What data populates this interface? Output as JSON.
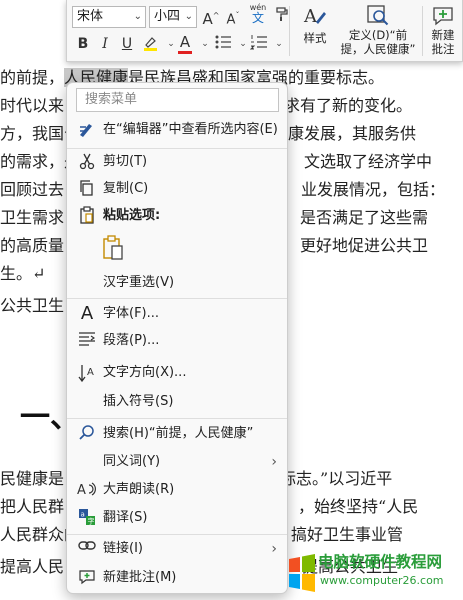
{
  "document": {
    "lines": [
      {
        "pre": "的前提，",
        "sel": "人民健康",
        "post": "是民族昌盛和国家富强的重要标志。"
      },
      {
        "pre": "时代以来",
        "sel": "",
        "post": "求有了新的变化。"
      },
      {
        "pre": "方，我国公",
        "sel": "",
        "post": "康发展，其服务供"
      },
      {
        "pre": "的需求，是",
        "sel": "",
        "post": "文选取了经济学中"
      },
      {
        "pre": "回顾过去",
        "sel": "",
        "post": "业发展情况，包括："
      },
      {
        "pre": "卫生需求，",
        "sel": "",
        "post": "是否满足了这些需"
      },
      {
        "pre": "的高质量",
        "sel": "",
        "post": "更好地促进公共卫"
      },
      {
        "pre": "生。↵",
        "sel": "",
        "post": ""
      },
      {
        "pre": "公共卫生",
        "sel": "",
        "post": ""
      }
    ],
    "heading": "一、",
    "lower_lines": [
      {
        "pre": "民健康是",
        "post": "标志。”以习近平"
      },
      {
        "pre": "把人民群",
        "post": "，始终坚持“人民"
      },
      {
        "pre": "人民群众的",
        "post": "搞好卫生事业管"
      },
      {
        "pre": "提高人民",
        "post": "提高公共卫生"
      }
    ]
  },
  "toolbar": {
    "font_name": "宋体",
    "font_size": "小四",
    "styles_label": "样式",
    "define_label_1": "定义(D)“前",
    "define_label_2": "提，人民健康”",
    "new_comment_1": "新建",
    "new_comment_2": "批注",
    "wen_label": "wén",
    "wen_char": "文"
  },
  "menu": {
    "search_placeholder": "搜索菜单",
    "items": [
      {
        "label": "在“编辑器”中查看所选内容(E)",
        "icon": "editor-icon"
      },
      {
        "label": "剪切(T)",
        "icon": "scissors-icon"
      },
      {
        "label": "复制(C)",
        "icon": "copy-icon"
      },
      {
        "label": "粘贴选项:",
        "icon": "paste-icon"
      },
      {
        "label": "汉字重选(V)",
        "icon": ""
      },
      {
        "label": "字体(F)...",
        "icon": "font-icon"
      },
      {
        "label": "段落(P)...",
        "icon": "paragraph-icon"
      },
      {
        "label": "文字方向(X)...",
        "icon": "text-direction-icon"
      },
      {
        "label": "插入符号(S)",
        "icon": ""
      },
      {
        "label": "搜索(H)“前提，人民健康”",
        "icon": "search-icon"
      },
      {
        "label": "同义词(Y)",
        "icon": ""
      },
      {
        "label": "大声朗读(R)",
        "icon": "read-aloud-icon"
      },
      {
        "label": "翻译(S)",
        "icon": "translate-icon"
      },
      {
        "label": "链接(I)",
        "icon": "link-icon"
      },
      {
        "label": "新建批注(M)",
        "icon": "new-comment-icon"
      }
    ]
  },
  "watermark": {
    "title": "电脑软硬件教程网",
    "url": "www.computer26.com"
  },
  "colors": {
    "accent": "#2b579a",
    "highlight": "#ffe600",
    "font_color": "#e02020",
    "watermark_green": "#2a9d3a"
  }
}
